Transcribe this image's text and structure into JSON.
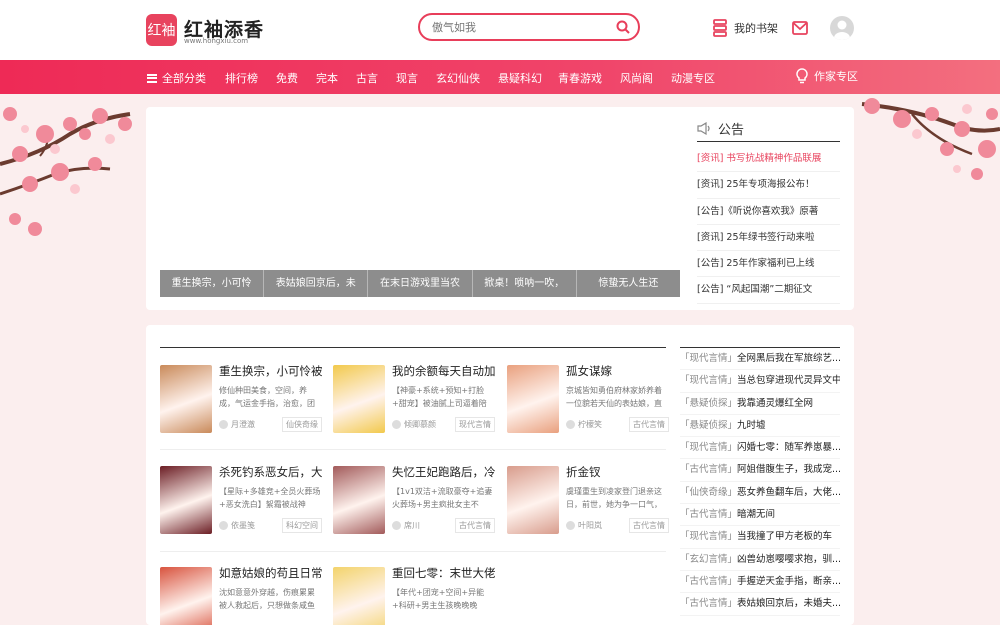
{
  "header": {
    "logo_mark": "红袖",
    "logo_text": "红袖添香",
    "logo_url": "www.hongxiu.com",
    "search_placeholder": "傲气如我",
    "shelf_label": "我的书架"
  },
  "nav": {
    "all_label": "全部分类",
    "items": [
      "排行榜",
      "免费",
      "完本",
      "古言",
      "现言",
      "玄幻仙侠",
      "悬疑科幻",
      "青春游戏",
      "风尚阁",
      "动漫专区"
    ],
    "writer_label": "作家专区"
  },
  "banner": {
    "tabs": [
      "重生换宗，小可怜",
      "表姑娘回京后，未",
      "在末日游戏里当农",
      "掀桌！唢呐一吹，",
      "惊蛰无人生还"
    ]
  },
  "notice": {
    "title": "公告",
    "items": [
      "[资讯] 书写抗战精神作品联展",
      "[资讯] 25年专项海报公布！",
      "[公告]《听说你喜欢我》原著",
      "[资讯] 25年绿书签行动来啦",
      "[公告] 25年作家福利已上线",
      "[公告] “风起国潮”二期征文"
    ]
  },
  "books": [
    {
      "title": "重生换宗，小可怜被",
      "desc": "修仙种田美食，空间，养成，气运金手指，治愈，团",
      "author": "月澄澈",
      "tag": "仙侠奇缘",
      "color": "#c98a5a"
    },
    {
      "title": "我的余额每天自动加",
      "desc": "【神豪+系统+预知+打脸+甜宠】被油腻上司逼着陪",
      "author": "倾卿慕颜",
      "tag": "现代言情",
      "color": "#f2c94c"
    },
    {
      "title": "孤女谋嫁",
      "desc": "京城皆知勇伯府林家娇养着一位貌若天仙的表姑娘，直",
      "author": "柠檬笑",
      "tag": "古代言情",
      "color": "#e9a07e"
    },
    {
      "title": "杀死钓系恶女后，大",
      "desc": "【星际+多雄竞+全员火葬场+恶女洗白】絮霜被战神",
      "author": "依墨笺",
      "tag": "科幻空间",
      "color": "#6b1d24"
    },
    {
      "title": "失忆王妃跑路后，冷",
      "desc": "【1v1双洁+流取豪夺+追妻火葬场+男主疯批女主不",
      "author": "席川",
      "tag": "古代言情",
      "color": "#a25a5a"
    },
    {
      "title": "折金钗",
      "desc": "虞瑾重生到凌家登门退亲这日，前世，她为争一口气，",
      "author": "叶阳岚",
      "tag": "古代言情",
      "color": "#d89c8c"
    },
    {
      "title": "如意姑娘的苟且日常",
      "desc": "沈如意意外穿越，伤痕累累被人救起后，只想做条咸鱼",
      "author": "",
      "tag": "",
      "color": "#d8533e"
    },
    {
      "title": "重回七零：末世大佬",
      "desc": "【年代+团宠+空间+异能+科研+男主生孩晚晚晚",
      "author": "",
      "tag": "",
      "color": "#f3d36b"
    }
  ],
  "ranking": [
    {
      "cat": "「现代言情」",
      "title": "全网黑后我在军旅综艺..."
    },
    {
      "cat": "「现代言情」",
      "title": "当总包穿进现代灵异文中"
    },
    {
      "cat": "「悬疑侦探」",
      "title": "我靠通灵爆红全网"
    },
    {
      "cat": "「悬疑侦探」",
      "title": "九时墟"
    },
    {
      "cat": "「现代言情」",
      "title": "闪婚七零：随军养崽暴..."
    },
    {
      "cat": "「古代言情」",
      "title": "阿姐借腹生子，我成宠..."
    },
    {
      "cat": "「仙侠奇缘」",
      "title": "恶女养鱼翻车后，大佬..."
    },
    {
      "cat": "「古代言情」",
      "title": "暗潮无间"
    },
    {
      "cat": "「现代言情」",
      "title": "当我撞了甲方老板的车"
    },
    {
      "cat": "「玄幻言情」",
      "title": "凶兽幼崽嘤嘤求抱，驯..."
    },
    {
      "cat": "「古代言情」",
      "title": "手握逆天金手指，断亲..."
    },
    {
      "cat": "「古代言情」",
      "title": "表姑娘回京后，未婚夫..."
    }
  ],
  "colors": {
    "brand": "#e8435e",
    "nav": "#ee2a56"
  }
}
